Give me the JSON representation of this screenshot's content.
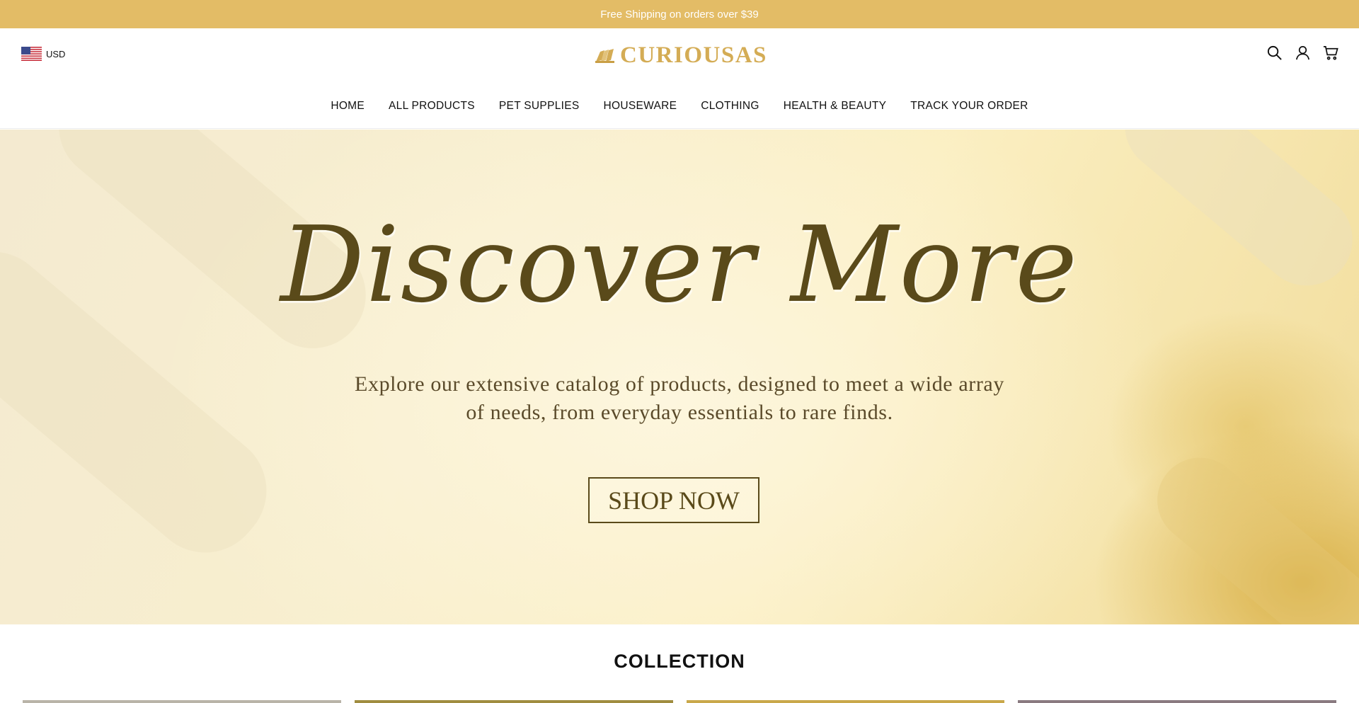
{
  "announcement": "Free Shipping on orders over $39",
  "currency": {
    "code": "USD",
    "flag_icon": "us-flag-icon"
  },
  "brand": {
    "name": "CURIOUSAS",
    "color": "#d4ac55"
  },
  "header_icons": [
    "search-icon",
    "account-icon",
    "cart-icon"
  ],
  "nav": [
    {
      "label": "HOME"
    },
    {
      "label": "ALL PRODUCTS"
    },
    {
      "label": "PET SUPPLIES"
    },
    {
      "label": "HOUSEWARE"
    },
    {
      "label": "CLOTHING"
    },
    {
      "label": "HEALTH & BEAUTY"
    },
    {
      "label": "TRACK YOUR ORDER"
    }
  ],
  "hero": {
    "title": "Discover More",
    "subtitle_line1": "Explore our extensive catalog of products, designed to meet a wide array",
    "subtitle_line2": "of needs, from everyday essentials to rare finds.",
    "cta": "SHOP NOW"
  },
  "collection": {
    "title": "COLLECTION"
  },
  "colors": {
    "announcement_bg": "#e3bc66",
    "hero_text": "#5a4a1a"
  }
}
